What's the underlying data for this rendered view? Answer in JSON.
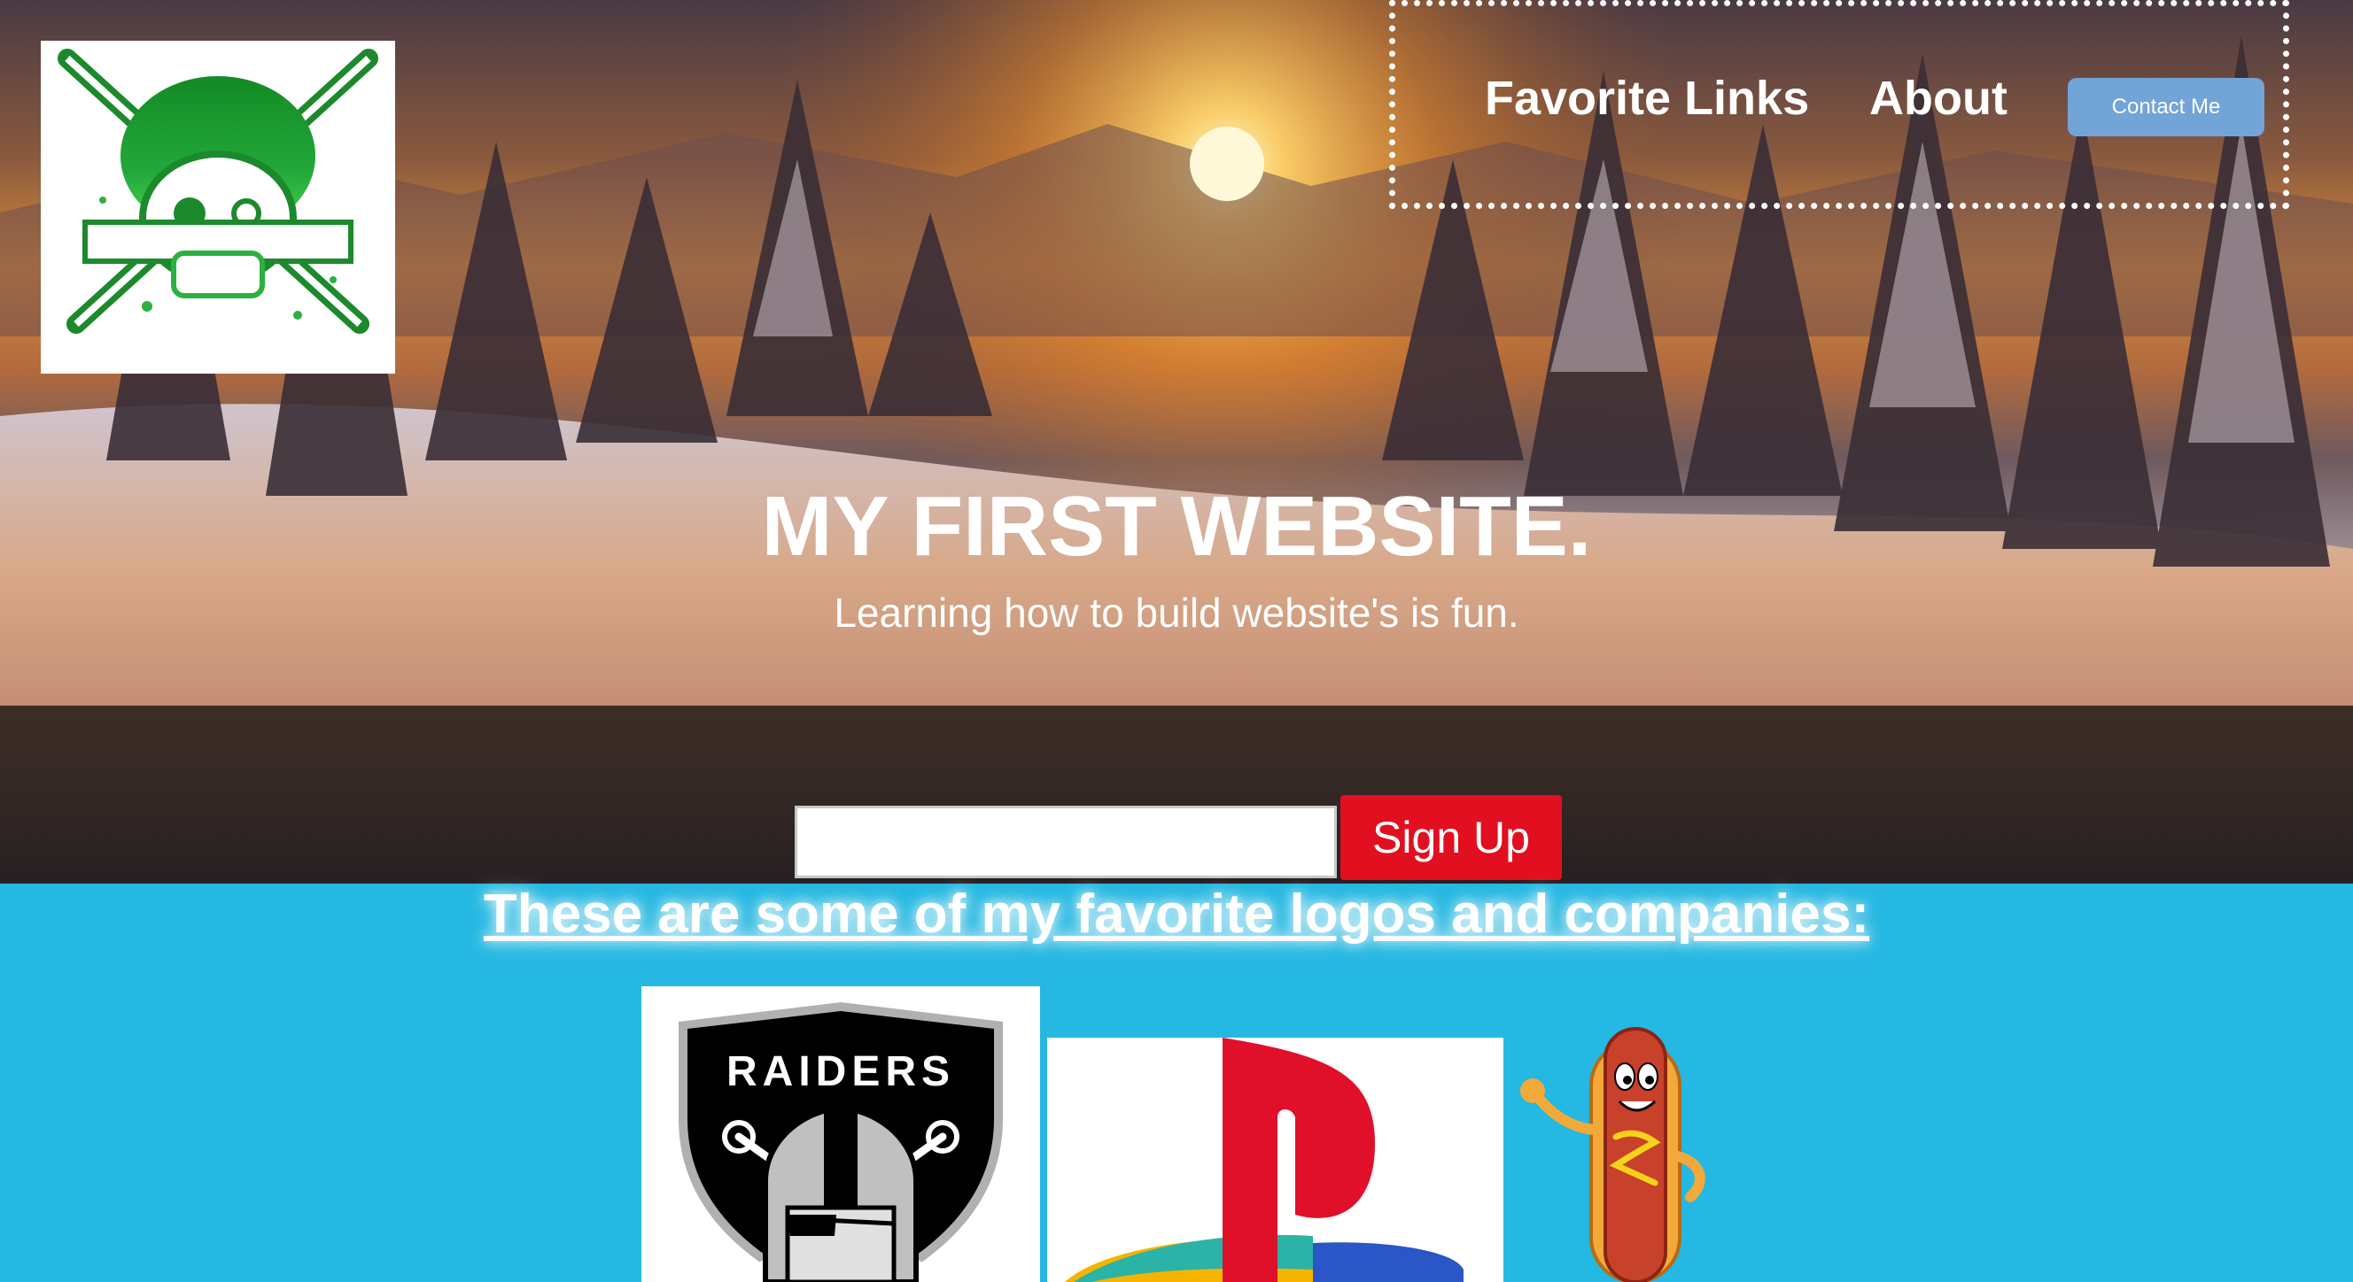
{
  "nav": {
    "favorite_links": "Favorite Links",
    "about": "About",
    "contact_button": "Contact Me"
  },
  "hero": {
    "title": "MY FIRST WEBSITE.",
    "subtitle": "Learning how to build website's is fun."
  },
  "signup": {
    "input_value": "",
    "button_label": "Sign Up"
  },
  "logos_section": {
    "heading": "These are some of my favorite logos and companies:",
    "raiders_text": "RAIDERS"
  },
  "icons": {
    "site_logo": "skull-crossed-swords-icon",
    "raiders_logo": "raiders-shield-icon",
    "playstation_logo": "playstation-logo-icon",
    "hotdog_mascot": "hotdog-mascot-icon"
  },
  "colors": {
    "section_background": "#24b8e2",
    "signup_button": "#e10f1f",
    "contact_button": "#72a4d8",
    "site_logo_green": "#1a8a2e"
  }
}
